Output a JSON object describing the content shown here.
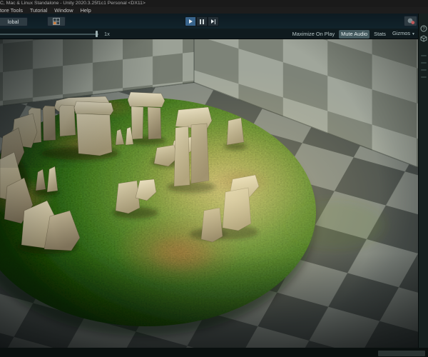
{
  "window": {
    "title": "C, Mac & Linux Standalone - Unity 2020.3.25f1c1 Personal <DX11>"
  },
  "menu": {
    "items": [
      "tore Tools",
      "Tutorial",
      "Window",
      "Help"
    ]
  },
  "toolbar": {
    "global_label": "lobal",
    "play_active": true
  },
  "game_toolbar": {
    "scale_label": "1x",
    "maximize_on_play": "Maximize On Play",
    "mute_audio": "Mute Audio",
    "stats": "Stats",
    "gizmos": "Gizmos",
    "mute_audio_active": true
  },
  "scene": {
    "description": "Stonehenge stone circle on a round grass mound, lit by a warm spotlight, inside a gray checkered room (Unity Game view in play mode)"
  },
  "colors": {
    "play_button_active": "#38648c",
    "toolbar_background": "#0d1a21",
    "active_toggle": "#43595e",
    "grass_center": "#c9bc62",
    "grass_edge": "#16380b",
    "stone_light": "#ece4ca",
    "stone_dark": "#665c45",
    "checker_wall_light": "#9ba196",
    "checker_wall_dark": "#767c71",
    "checker_floor_light": "#828881",
    "checker_floor_dark": "#4c524e"
  }
}
